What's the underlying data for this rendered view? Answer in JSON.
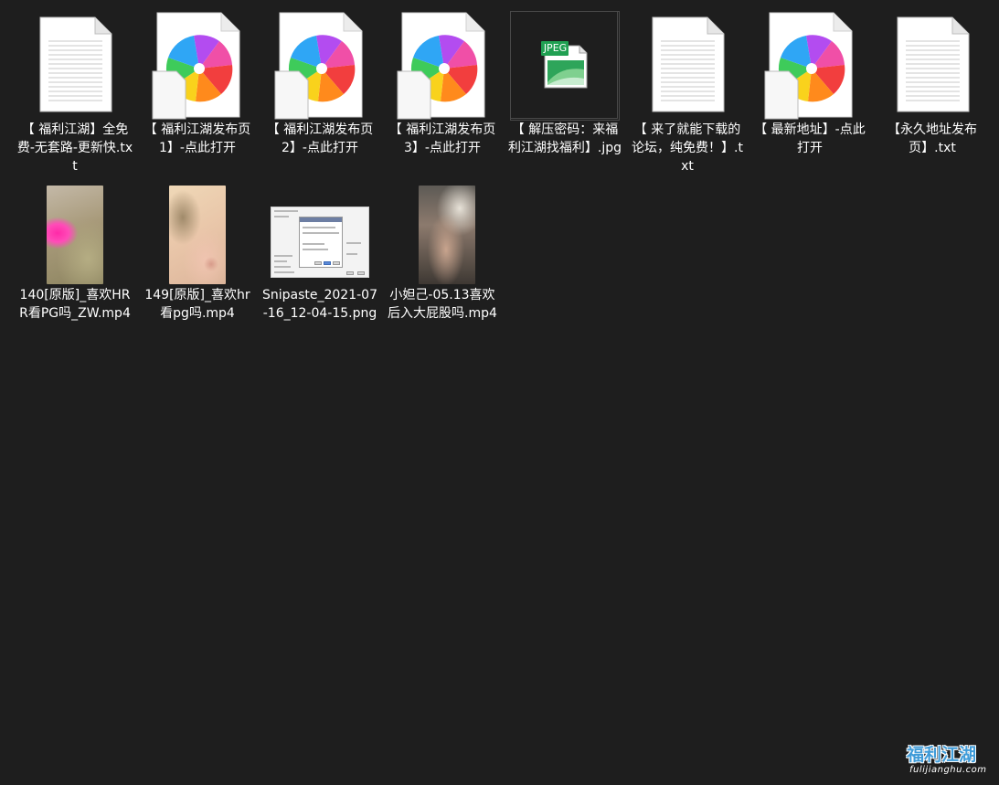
{
  "colors": {
    "background": "#1e1e1e",
    "text": "#ffffff",
    "selected_border": "#4a4a4a",
    "watermark": "#3f9bd8"
  },
  "files": [
    {
      "label": "【 福利江湖】全免费-无套路-更新快.txt",
      "icon": "text-document-icon"
    },
    {
      "label": "【 福利江湖发布页1】-点此打开",
      "icon": "photos-app-shortcut-icon"
    },
    {
      "label": "【 福利江湖发布页2】-点此打开",
      "icon": "photos-app-shortcut-icon"
    },
    {
      "label": "【 福利江湖发布页3】-点此打开",
      "icon": "photos-app-shortcut-icon"
    },
    {
      "label": "【 解压密码：来福利江湖找福利】.jpg",
      "icon": "jpeg-image-icon",
      "selected": true
    },
    {
      "label": "【 来了就能下载的论坛，纯免费！】.txt",
      "icon": "text-document-icon"
    },
    {
      "label": "【 最新地址】-点此打开",
      "icon": "photos-app-shortcut-icon"
    },
    {
      "label": "【永久地址发布页】.txt",
      "icon": "text-document-icon"
    },
    {
      "label": "140[原版]_喜欢HRR看PG吗_ZW.mp4",
      "icon": "video-thumbnail"
    },
    {
      "label": "149[原版]_喜欢hr看pg吗.mp4",
      "icon": "video-thumbnail"
    },
    {
      "label": "Snipaste_2021-07-16_12-04-15.png",
      "icon": "screenshot-thumbnail"
    },
    {
      "label": "小妲己-05.13喜欢后入大屁股吗.mp4",
      "icon": "video-thumbnail"
    }
  ],
  "jpeg_badge": "JPEG",
  "watermark": {
    "title": "福利江湖",
    "subtitle": "fulijianghu.com"
  }
}
